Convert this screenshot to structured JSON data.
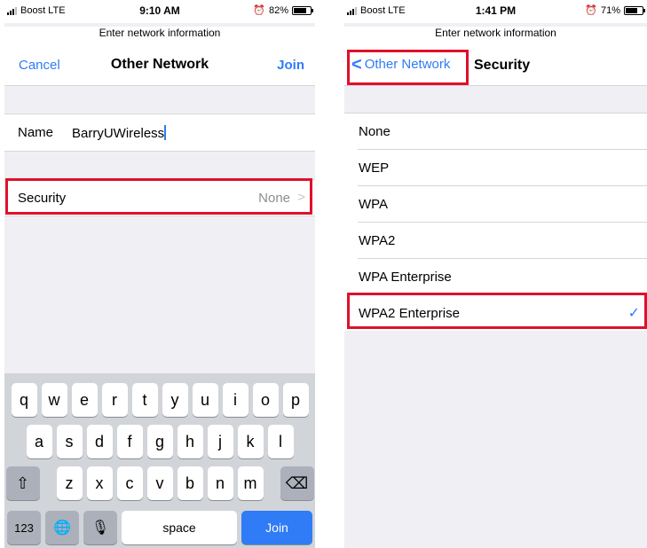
{
  "left_screen": {
    "status": {
      "carrier": "Boost  LTE",
      "time": "9:10 AM",
      "battery": "82%",
      "battery_level": 0.82
    },
    "prompt": "Enter network information",
    "nav": {
      "cancel": "Cancel",
      "title": "Other Network",
      "join": "Join"
    },
    "name_field": {
      "label": "Name",
      "value": "BarryUWireless"
    },
    "security_field": {
      "label": "Security",
      "value": "None"
    },
    "keyboard": {
      "row1": [
        "q",
        "w",
        "e",
        "r",
        "t",
        "y",
        "u",
        "i",
        "o",
        "p"
      ],
      "row2": [
        "a",
        "s",
        "d",
        "f",
        "g",
        "h",
        "j",
        "k",
        "l"
      ],
      "row3": [
        "z",
        "x",
        "c",
        "v",
        "b",
        "n",
        "m"
      ],
      "numbers_key": "123",
      "space_key": "space",
      "join_key": "Join"
    }
  },
  "right_screen": {
    "status": {
      "carrier": "Boost  LTE",
      "time": "1:41 PM",
      "battery": "71%",
      "battery_level": 0.71
    },
    "prompt": "Enter network information",
    "nav": {
      "back": "Other Network",
      "title": "Security"
    },
    "options": [
      "None",
      "WEP",
      "WPA",
      "WPA2",
      "WPA Enterprise",
      "WPA2 Enterprise"
    ],
    "selected": "WPA2 Enterprise"
  },
  "colors": {
    "accent": "#2f7cf6",
    "highlight": "#e0102a",
    "keyboard_bg": "#d1d4d9"
  }
}
